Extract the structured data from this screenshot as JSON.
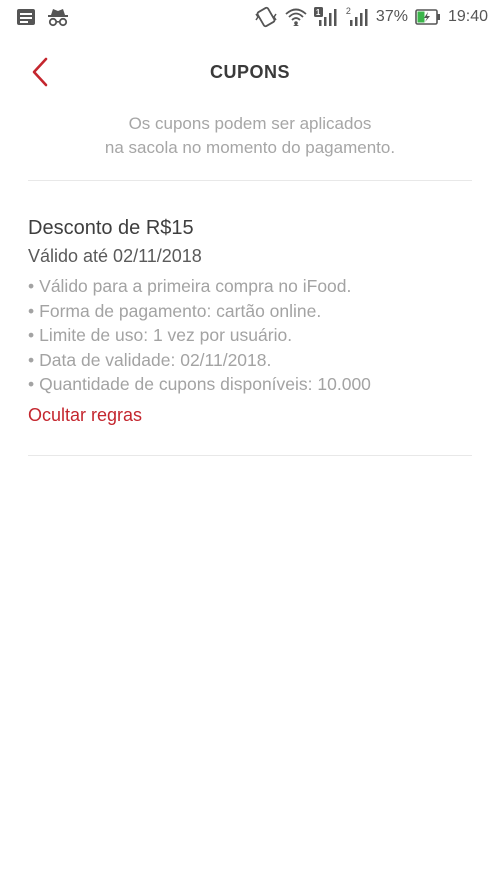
{
  "status_bar": {
    "icons_left": [
      "notification-icon",
      "incognito-icon"
    ],
    "icons_right": [
      "vibrate-icon",
      "wifi-icon",
      "signal-sim1-icon",
      "signal-sim2-icon"
    ],
    "sim1_badge": "1",
    "sim2_badge": "2",
    "battery": "37%",
    "time": "19:40"
  },
  "header": {
    "title": "CUPONS",
    "back_icon": "chevron-left-icon",
    "accent_color": "#c4262e"
  },
  "subtitle": {
    "line1": "Os cupons podem ser aplicados",
    "line2": "na sacola no momento do pagamento."
  },
  "coupon": {
    "title": "Desconto de R$15",
    "validity": "Válido até 02/11/2018",
    "rules": [
      "Válido para a primeira compra no iFood.",
      "Forma de pagamento: cartão online.",
      "Limite de uso: 1 vez por usuário.",
      "Data de validade: 02/11/2018.",
      "Quantidade de cupons disponíveis: 10.000"
    ],
    "toggle_label": "Ocultar regras"
  }
}
